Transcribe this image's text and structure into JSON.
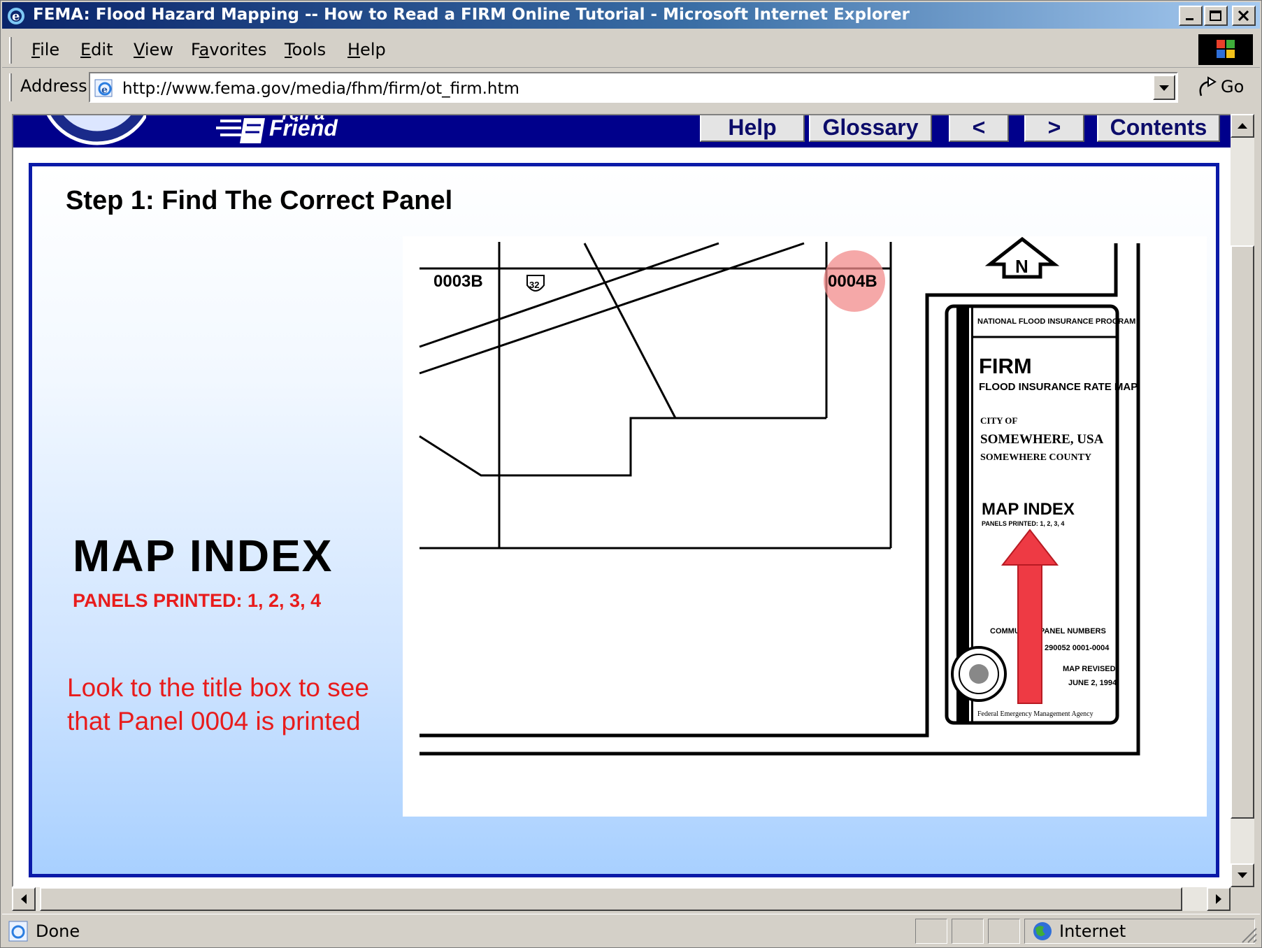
{
  "window": {
    "title": "FEMA: Flood Hazard Mapping -- How to Read a FIRM Online Tutorial - Microsoft Internet Explorer"
  },
  "menu": {
    "items": [
      {
        "label": "File",
        "ul": "F",
        "rest": "ile"
      },
      {
        "label": "Edit",
        "ul": "E",
        "rest": "dit"
      },
      {
        "label": "View",
        "ul": "V",
        "rest": "iew"
      },
      {
        "label": "Favorites",
        "pre": "F",
        "ul": "a",
        "rest": "vorites"
      },
      {
        "label": "Tools",
        "ul": "T",
        "rest": "ools"
      },
      {
        "label": "Help",
        "ul": "H",
        "rest": "elp"
      }
    ]
  },
  "address": {
    "label": "Address",
    "url": "http://www.fema.gov/media/fhm/firm/ot_firm.htm",
    "go_label": "Go"
  },
  "fema_header": {
    "tell_label": "Tell a",
    "friend_label": "Friend",
    "nav": {
      "help": "Help",
      "glossary": "Glossary",
      "prev": "<",
      "next": ">",
      "contents": "Contents"
    }
  },
  "tutorial": {
    "step_title": "Step 1: Find The Correct Panel",
    "map_index_heading": "MAP INDEX",
    "panels_printed": "PANELS PRINTED: 1, 2, 3, 4",
    "instruction": "Look to the title box to see that Panel 0004 is printed",
    "map": {
      "panel_left": "0003B",
      "panel_right": "0004B",
      "route_shield": "32",
      "north_label": "N",
      "highlight_color": "#f28b8b",
      "arrow_color": "#ee3a44"
    },
    "title_box": {
      "program": "NATIONAL FLOOD INSURANCE PROGRAM",
      "firm": "FIRM",
      "firm_full": "FLOOD INSURANCE RATE MAP",
      "city_of": "CITY OF",
      "city": "SOMEWHERE, USA",
      "county": "SOMEWHERE COUNTY",
      "map_index": "MAP INDEX",
      "panels_printed_small": "PANELS PRINTED: 1, 2, 3, 4",
      "community_panel_label": "COMMUNITY-PANEL NUMBERS",
      "community_panel_number": "290052  0001-0004",
      "map_revised_label": "MAP REVISED:",
      "map_revised_date": "JUNE 2, 1994",
      "agency": "Federal Emergency Management Agency"
    }
  },
  "status": {
    "text": "Done",
    "zone": "Internet"
  },
  "colors": {
    "titlebar_start": "#0a246a",
    "fema_blue": "#00008b",
    "frame_border": "#0a1aa8",
    "accent_red": "#e81c1c"
  }
}
